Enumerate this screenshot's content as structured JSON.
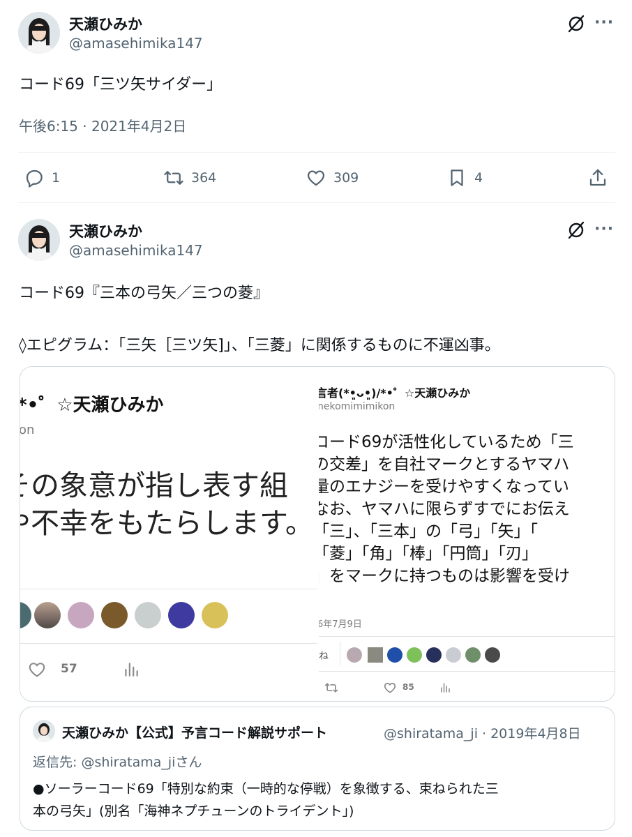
{
  "tweet1": {
    "name": "天瀬ひみか",
    "handle": "@amasehimika147",
    "text": "コード69「三ツ矢サイダー」",
    "timestamp": "午後6:15 · 2021年4月2日",
    "replies": "1",
    "retweets": "364",
    "likes": "309",
    "bookmarks": "4",
    "more_label": "···"
  },
  "tweet2": {
    "name": "天瀬ひみか",
    "handle": "@amasehimika147",
    "text_line1": "コード69『三本の弓矢／三つの菱』",
    "text_line2": "◊エピグラム：「三矢［三ツ矢]」、「三菱」に関係するものに不運凶事。",
    "more_label": "···"
  },
  "media_left": {
    "header": "*•゜☆天瀬ひみか",
    "handle_fragment": "on",
    "text_line1": "その象意が指し表す組",
    "text_line2": "や不幸をもたらします。",
    "likes": "57"
  },
  "media_right": {
    "header": "言者(*•͈ᴗ•͈)/*•゜☆天瀬ひみか",
    "handle": "nekomimimikon",
    "lines": [
      "コード69が活性化しているため「三",
      "の交差」を自社マークとするヤマハ",
      "量のエナジーを受けやすくなってい",
      "なお、ヤマハに限らずすでにお伝え",
      "「三」、「三本」の「弓」「矢」「",
      "「菱」「角」「棒」「円筒」「刃」",
      "」をマークに持つものは影響を受け"
    ],
    "date": "6年7月9日",
    "likes_label": "ね",
    "likes": "85"
  },
  "quote": {
    "name": "天瀬ひみか【公式】予言コード解説サポート",
    "handle_date": "@shiratama_ji · 2019年4月8日",
    "reply_to": "返信先: @shiratama_jiさん",
    "text_line1": "●ソーラーコード69「特別な約束（一時的な停戦）を象徴する、束ねられた三",
    "text_line2": "本の弓矢」(別名「海神ネプチューンのトライデント」)"
  },
  "colors": {
    "text": "#0f1419",
    "muted": "#536471",
    "border": "#cfd9de",
    "divider": "#eff3f4"
  },
  "icons": [
    "avatar",
    "grok-icon",
    "more-icon",
    "reply-icon",
    "retweet-icon",
    "like-icon",
    "bookmark-icon",
    "share-icon",
    "views-icon"
  ]
}
